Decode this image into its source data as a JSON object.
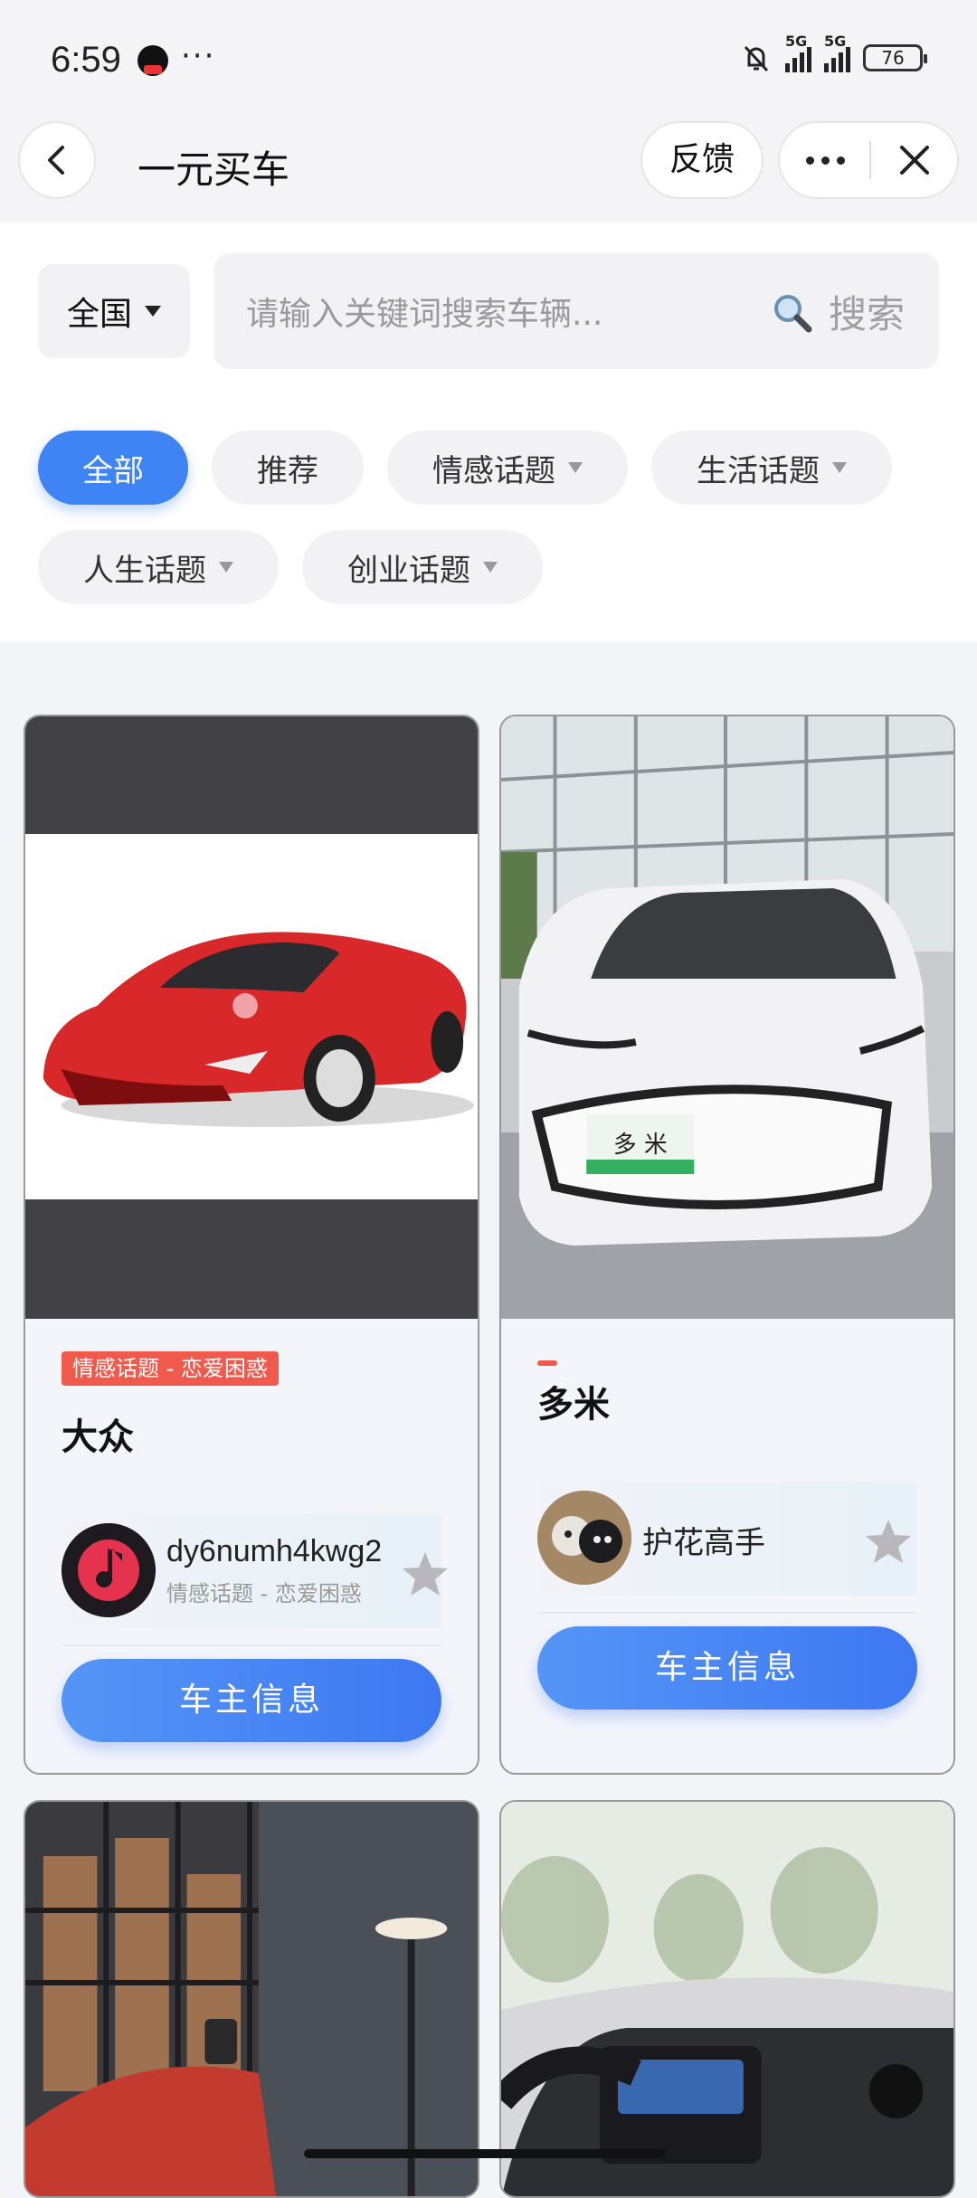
{
  "status_bar": {
    "time": "6:59",
    "dots": "···",
    "signal1": "5G",
    "signal2": "5G",
    "battery": "76"
  },
  "nav": {
    "title": "一元买车",
    "feedback": "反馈"
  },
  "search": {
    "region": "全国",
    "placeholder": "请输入关键词搜索车辆...",
    "button": "搜索"
  },
  "filters": [
    {
      "label": "全部",
      "active": true
    },
    {
      "label": "推荐"
    },
    {
      "label": "情感话题",
      "dropdown": true
    },
    {
      "label": "生活话题",
      "dropdown": true
    },
    {
      "label": "人生话题",
      "dropdown": true
    },
    {
      "label": "创业话题",
      "dropdown": true
    }
  ],
  "cards": [
    {
      "tag": "情感话题 - 恋爱困惑",
      "title": "大众",
      "owner_name": "dy6numh4kwg2",
      "owner_sub": "情感话题 - 恋爱困惑",
      "button": "车主信息"
    },
    {
      "title": "多米",
      "owner_name": "护花高手",
      "button": "车主信息",
      "plate": "多 米"
    }
  ],
  "colors": {
    "accent": "#3f84f5",
    "tag": "#ef5a4c"
  }
}
